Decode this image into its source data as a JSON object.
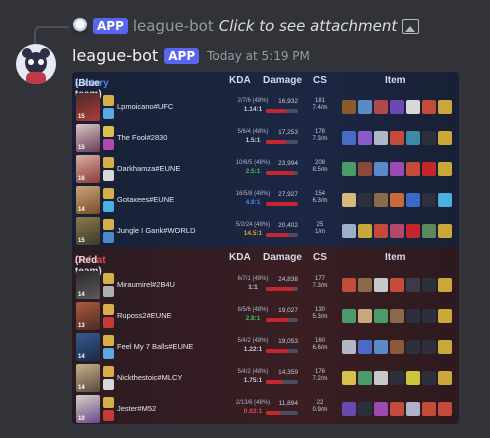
{
  "reply": {
    "bot_name": "league-bot",
    "badge": "APP",
    "text": "Click to see attachment"
  },
  "message": {
    "author": "league-bot",
    "badge": "APP",
    "timestamp": "Today at 5:19 PM"
  },
  "columns": {
    "kda": "KDA",
    "damage": "Damage",
    "cs": "CS",
    "item": "Item"
  },
  "teams": [
    {
      "result": "Victory",
      "side": "(Blue team)",
      "players": [
        {
          "name": "Lpmoicano#UFC",
          "level": "15",
          "kda_line": "2/7/6 (48%)",
          "kda_ratio": "1.14:1",
          "ratio_color": "#c8ccda",
          "damage": "16,932",
          "damage_share": 0.61,
          "cs": "181",
          "cs_min": "7.4/m",
          "champ_colors": [
            "#4a2a2a",
            "#b03a3a"
          ],
          "spells": [
            "#d8b04a",
            "#5aa8e0"
          ],
          "items": [
            "#8a5a2a",
            "#5a8ac8",
            "#b04a4a",
            "#6a4ab0",
            "#d8d8d8",
            "#c44a3a",
            "#caa83a"
          ]
        },
        {
          "name": "The Fool#2830",
          "level": "15",
          "kda_line": "5/6/4 (48%)",
          "kda_ratio": "1.5:1",
          "ratio_color": "#c8ccda",
          "damage": "17,253",
          "damage_share": 0.62,
          "cs": "178",
          "cs_min": "7.3/m",
          "champ_colors": [
            "#d8c8c0",
            "#6a3a5a"
          ],
          "spells": [
            "#d8c04a",
            "#b04ab0"
          ],
          "items": [
            "#4a6ac8",
            "#8a5ac8",
            "#b0b8c8",
            "#c44a3a",
            "#3a8aa8",
            "#2c2f3c",
            "#caa83a"
          ]
        },
        {
          "name": "Darkhamza#EUNE",
          "level": "16",
          "kda_line": "10/6/5 (48%)",
          "kda_ratio": "2.5:1",
          "ratio_color": "#3fbf5a",
          "damage": "23,994",
          "damage_share": 0.86,
          "cs": "208",
          "cs_min": "8.5/m",
          "champ_colors": [
            "#d8b0a0",
            "#8a3a3a"
          ],
          "spells": [
            "#d8b04a",
            "#d8d8d8"
          ],
          "items": [
            "#4a9a6a",
            "#8a4a3a",
            "#5a8ac8",
            "#9a4ab0",
            "#c44a3a",
            "#c4262d",
            "#caa83a"
          ]
        },
        {
          "name": "Gotaxees#EUNE",
          "level": "14",
          "kda_line": "16/5/8 (48%)",
          "kda_ratio": "4.8:1",
          "ratio_color": "#4f86e0",
          "damage": "27,927",
          "damage_share": 1.0,
          "cs": "154",
          "cs_min": "6.3/m",
          "champ_colors": [
            "#c8a87a",
            "#7a4a2a"
          ],
          "spells": [
            "#d8b04a",
            "#4ab0e0"
          ],
          "items": [
            "#d8b87a",
            "#2c2f3c",
            "#8a6a4a",
            "#c86a3a",
            "#3a6ac8",
            "#2c2f3c",
            "#4ab0e0"
          ]
        },
        {
          "name": "Jungle I Gank#WORLD",
          "level": "15",
          "kda_line": "5/2/24 (48%)",
          "kda_ratio": "14.5:1",
          "ratio_color": "#e0a020",
          "damage": "20,402",
          "damage_share": 0.73,
          "cs": "25",
          "cs_min": "1/m",
          "champ_colors": [
            "#8a7a4a",
            "#3a3a2a"
          ],
          "spells": [
            "#d8b04a",
            "#4a8ac8"
          ],
          "items": [
            "#9ab0c8",
            "#c8a83a",
            "#c44a3a",
            "#b04a6a",
            "#c4262d",
            "#5a8a5a",
            "#caa83a"
          ]
        }
      ]
    },
    {
      "result": "Defeat",
      "side": "(Red team)",
      "players": [
        {
          "name": "Miraumirel#2B4U",
          "level": "14",
          "kda_line": "6/7/1 (48%)",
          "kda_ratio": "1:1",
          "ratio_color": "#c8ccda",
          "damage": "24,838",
          "damage_share": 0.89,
          "cs": "177",
          "cs_min": "7.3/m",
          "champ_colors": [
            "#2a2a2a",
            "#5a5a5a"
          ],
          "spells": [
            "#d8b04a",
            "#b0b0b0"
          ],
          "items": [
            "#c44a3a",
            "#8a6a4a",
            "#c8c8c8",
            "#c44a3a",
            "#3a3a4a",
            "#2c2f3c",
            "#caa83a"
          ]
        },
        {
          "name": "Ruposs2#EUNE",
          "level": "13",
          "kda_line": "8/5/6 (48%)",
          "kda_ratio": "2.8:1",
          "ratio_color": "#3fbf5a",
          "damage": "19,027",
          "damage_share": 0.68,
          "cs": "130",
          "cs_min": "5.3/m",
          "champ_colors": [
            "#b05a3a",
            "#4a2a2a"
          ],
          "spells": [
            "#d8b04a",
            "#c83a3a"
          ],
          "items": [
            "#4a9a6a",
            "#c8a87a",
            "#4a9a6a",
            "#8a6a4a",
            "#2c2f3c",
            "#2c2f3c",
            "#caa83a"
          ]
        },
        {
          "name": "Feel My 7 Balls#EUNE",
          "level": "14",
          "kda_line": "5/4/2 (48%)",
          "kda_ratio": "1.22:1",
          "ratio_color": "#c8ccda",
          "damage": "19,053",
          "damage_share": 0.68,
          "cs": "160",
          "cs_min": "6.6/m",
          "champ_colors": [
            "#3a5a8a",
            "#1a2a4a"
          ],
          "spells": [
            "#d8b04a",
            "#5aa8e0"
          ],
          "items": [
            "#b0b8c8",
            "#4a6ac8",
            "#5a8ac8",
            "#8a5a3a",
            "#2c2f3c",
            "#2c2f3c",
            "#caa83a"
          ]
        },
        {
          "name": "Nickthestoic#MLCY",
          "level": "14",
          "kda_line": "5/4/2 (48%)",
          "kda_ratio": "1.75:1",
          "ratio_color": "#c8ccda",
          "damage": "14,359",
          "damage_share": 0.51,
          "cs": "176",
          "cs_min": "7.2/m",
          "champ_colors": [
            "#c8b08a",
            "#5a4a3a"
          ],
          "spells": [
            "#d8b04a",
            "#d8d8d8"
          ],
          "items": [
            "#d8c04a",
            "#4a9a6a",
            "#c8c8c8",
            "#2c2f3c",
            "#c8c83a",
            "#2c2f3c",
            "#caa83a"
          ]
        },
        {
          "name": "Jester#M52",
          "level": "10",
          "kda_line": "2/13/6 (48%)",
          "kda_ratio": "0.62:1",
          "ratio_color": "#e04b4b",
          "damage": "11,894",
          "damage_share": 0.43,
          "cs": "22",
          "cs_min": "0.9/m",
          "champ_colors": [
            "#d8d0c8",
            "#6a4a8a"
          ],
          "spells": [
            "#d8b04a",
            "#c83a3a"
          ],
          "items": [
            "#6a4ab0",
            "#2c2f3c",
            "#9a4ab0",
            "#c44a3a",
            "#b0b0c8",
            "#c44a3a",
            "#c44a3a"
          ]
        }
      ]
    }
  ],
  "icons": [
    "image-attachment-icon",
    "reply-avatar",
    "bot-avatar",
    "champion-portrait",
    "summoner-spell-icon",
    "item-icon"
  ]
}
